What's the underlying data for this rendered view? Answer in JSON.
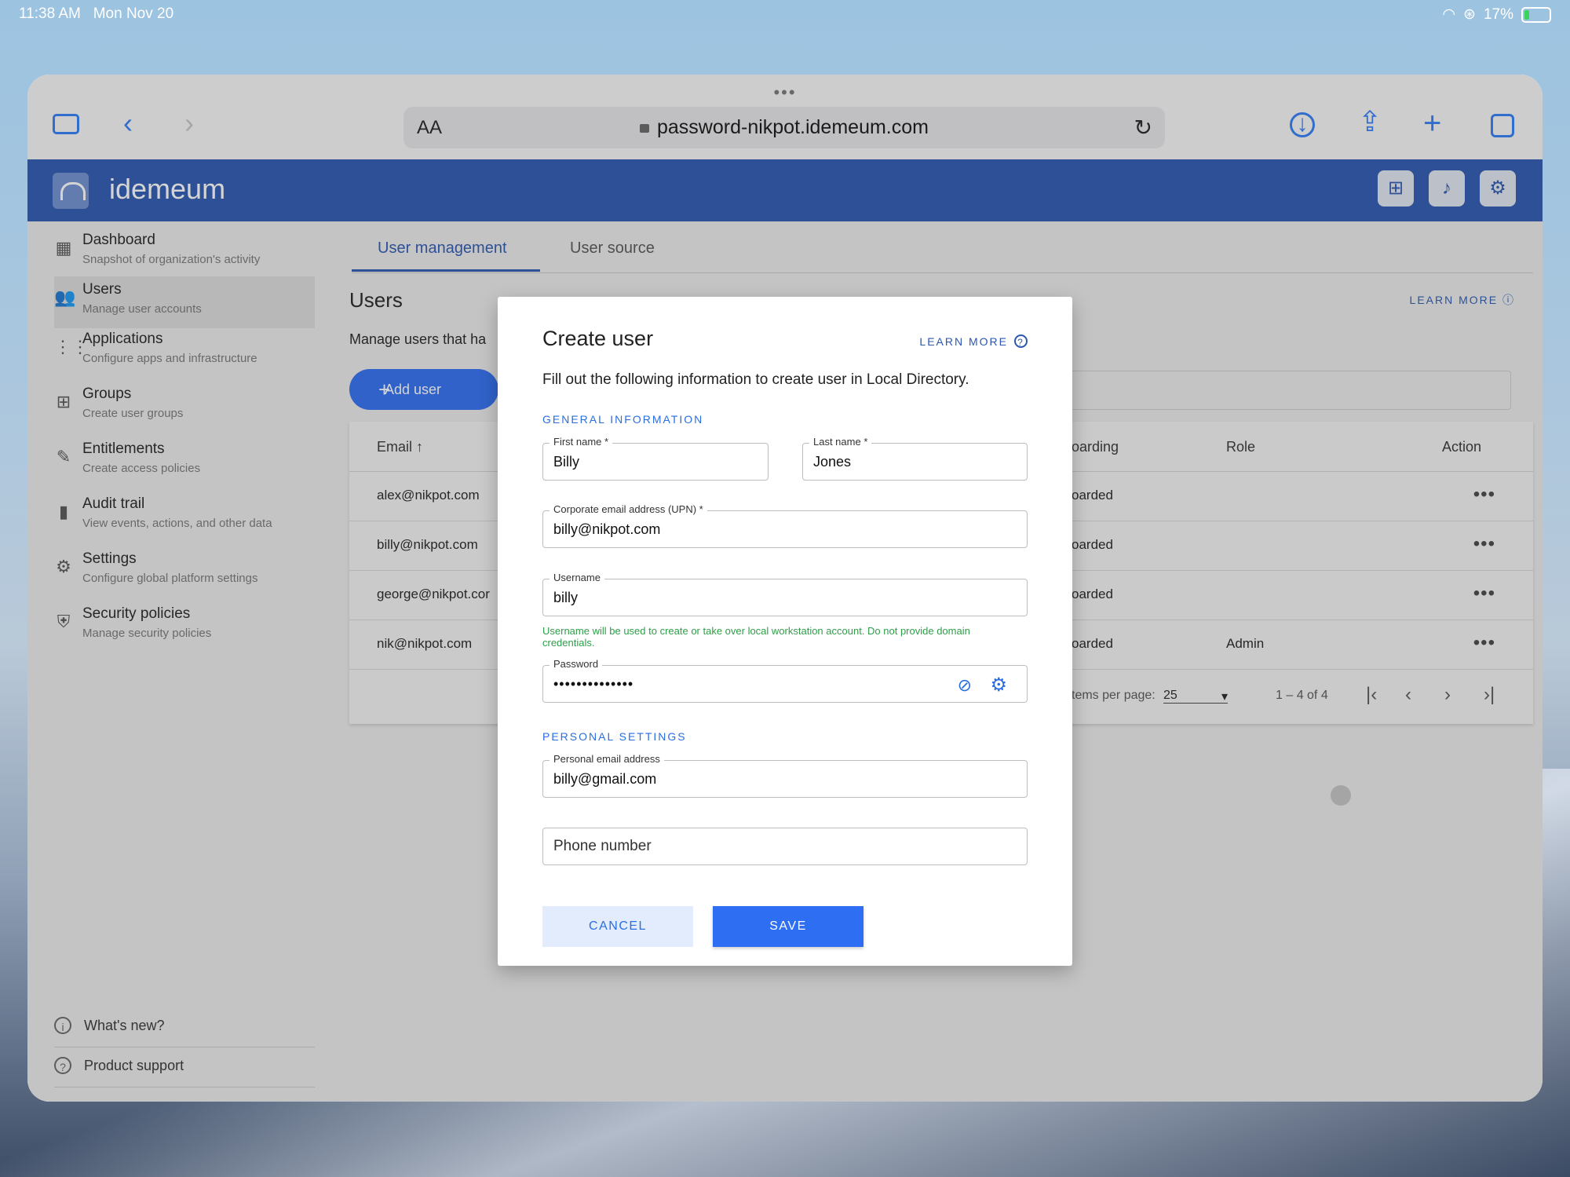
{
  "status_bar": {
    "time": "11:38 AM",
    "date": "Mon Nov 20",
    "battery": "17%"
  },
  "browser": {
    "aa": "AA",
    "url": "password-nikpot.idemeum.com"
  },
  "app": {
    "brand": "idemeum"
  },
  "sidebar": {
    "items": [
      {
        "title": "Dashboard",
        "sub": "Snapshot of organization's activity"
      },
      {
        "title": "Users",
        "sub": "Manage user accounts"
      },
      {
        "title": "Applications",
        "sub": "Configure apps and infrastructure"
      },
      {
        "title": "Groups",
        "sub": "Create user groups"
      },
      {
        "title": "Entitlements",
        "sub": "Create access policies"
      },
      {
        "title": "Audit trail",
        "sub": "View events, actions, and other data"
      },
      {
        "title": "Settings",
        "sub": "Configure global platform settings"
      },
      {
        "title": "Security policies",
        "sub": "Manage security policies"
      }
    ],
    "footer": {
      "whats_new": "What's new?",
      "support": "Product support"
    }
  },
  "main": {
    "tabs": [
      "User management",
      "User source"
    ],
    "heading": "Users",
    "learn_more": "LEARN MORE",
    "description": "Manage users that ha",
    "add_user": "Add user",
    "table": {
      "headers": {
        "email": "Email",
        "onboarding": "oarding",
        "role": "Role",
        "action": "Action"
      },
      "rows": [
        {
          "email": "alex@nikpot.com",
          "status": "oarded",
          "role": ""
        },
        {
          "email": "billy@nikpot.com",
          "status": "oarded",
          "role": ""
        },
        {
          "email": "george@nikpot.cor",
          "status": "oarded",
          "role": ""
        },
        {
          "email": "nik@nikpot.com",
          "status": "oarded",
          "role": "Admin"
        }
      ],
      "pager": {
        "items_label": "tems per page:",
        "per_page": "25",
        "range": "1 – 4 of 4"
      }
    }
  },
  "dialog": {
    "title": "Create user",
    "learn_more": "LEARN MORE",
    "description": "Fill out the following information to create user in Local Directory.",
    "section_general": "GENERAL INFORMATION",
    "first_name": {
      "label": "First name *",
      "value": "Billy"
    },
    "last_name": {
      "label": "Last name *",
      "value": "Jones"
    },
    "corp_email": {
      "label": "Corporate email address (UPN) *",
      "value": "billy@nikpot.com"
    },
    "username": {
      "label": "Username",
      "value": "billy"
    },
    "username_hint": "Username will be used to create or take over local workstation account. Do not provide domain credentials.",
    "password": {
      "label": "Password",
      "value": "••••••••••••••"
    },
    "section_personal": "PERSONAL SETTINGS",
    "personal_email": {
      "label": "Personal email address",
      "value": "billy@gmail.com"
    },
    "phone": {
      "placeholder": "Phone number"
    },
    "cancel": "CANCEL",
    "save": "SAVE"
  },
  "colors": {
    "brand": "#2a57b0",
    "primary": "#2d6ef2",
    "hint": "#2e9e48"
  }
}
